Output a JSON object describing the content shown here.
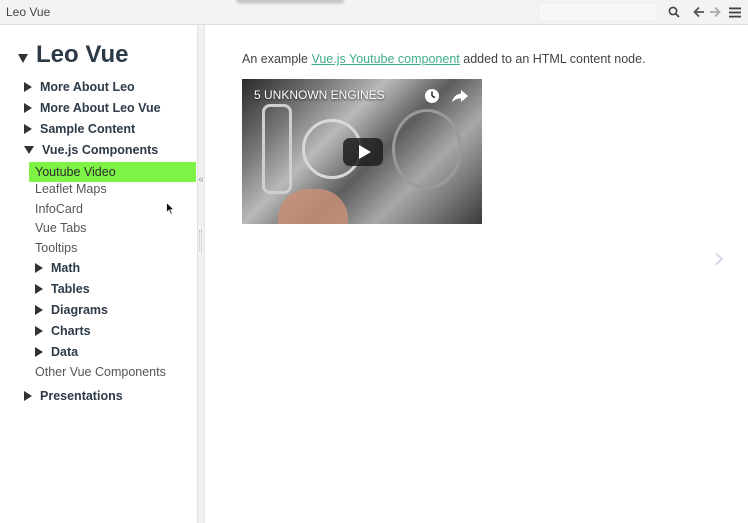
{
  "app": {
    "title": "Leo Vue"
  },
  "toolbar": {
    "search_icon": "search-icon",
    "back_icon": "arrow-left-icon",
    "forward_icon": "arrow-right-icon",
    "menu_icon": "hamburger-menu-icon"
  },
  "tree": {
    "title": "Leo Vue",
    "items": [
      {
        "label": "More About Leo",
        "type": "collapsed"
      },
      {
        "label": "More About Leo Vue",
        "type": "collapsed"
      },
      {
        "label": "Sample Content",
        "type": "collapsed"
      },
      {
        "label": "Vue.js Components",
        "type": "expanded"
      },
      {
        "label": "Youtube Video",
        "type": "leaf",
        "selected": true
      },
      {
        "label": "Leaflet Maps",
        "type": "leaf"
      },
      {
        "label": "InfoCard",
        "type": "leaf"
      },
      {
        "label": "Vue Tabs",
        "type": "leaf"
      },
      {
        "label": "Tooltips",
        "type": "leaf"
      },
      {
        "label": "Math",
        "type": "collapsed"
      },
      {
        "label": "Tables",
        "type": "collapsed"
      },
      {
        "label": "Diagrams",
        "type": "collapsed"
      },
      {
        "label": "Charts",
        "type": "collapsed"
      },
      {
        "label": "Data",
        "type": "collapsed"
      },
      {
        "label": "Other Vue Components",
        "type": "leaf"
      },
      {
        "label": "Presentations",
        "type": "collapsed"
      }
    ],
    "selected_color": "#7ef245"
  },
  "content": {
    "intro_before": "An example ",
    "intro_link": "Vue.js Youtube component",
    "intro_after": " added to an HTML content node.",
    "link_color": "#3fae8c",
    "video": {
      "title": "5 UNKNOWN ENGINES",
      "clock_icon": "clock-icon",
      "share_icon": "share-icon",
      "play_icon": "play-icon"
    }
  },
  "sidebar_toggle": "«",
  "next_icon": "chevron-right-icon"
}
